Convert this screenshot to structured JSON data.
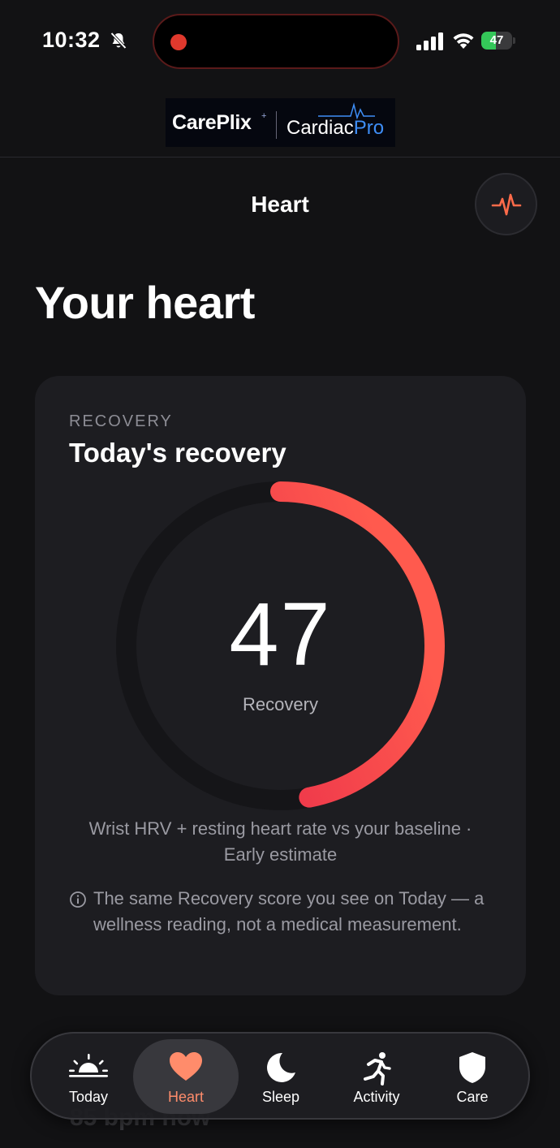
{
  "status_bar": {
    "time": "10:32",
    "battery_level": "47",
    "battery_fraction": 0.47,
    "icons": [
      "bell-slash-icon",
      "screen-recording-dot",
      "cellular-signal-icon",
      "wifi-icon",
      "battery-charging-icon"
    ]
  },
  "brand": {
    "primary": "CarePlix",
    "primary_mark": "+",
    "secondary_main": "Cardiac",
    "secondary_accent": "Pro"
  },
  "header": {
    "title": "Heart",
    "action_icon": "heartbeat-pulse-icon"
  },
  "page": {
    "heading": "Your heart"
  },
  "recovery_card": {
    "eyebrow": "RECOVERY",
    "title": "Today's recovery",
    "score": "47",
    "score_fraction": 0.47,
    "score_label": "Recovery",
    "method": "Wrist HRV + resting heart rate vs your baseline · Early estimate",
    "disclaimer": "The same Recovery score you see on Today — a wellness reading, not a medical measurement.",
    "colors": {
      "ring_start": "#e11d48",
      "ring_end": "#ff5a4e",
      "track": "#151518"
    }
  },
  "peek": {
    "text": "85 bpm now"
  },
  "tab_bar": {
    "active_color": "#ff8c6b",
    "tabs": [
      {
        "label": "Today",
        "icon": "sunrise-icon",
        "active": false
      },
      {
        "label": "Heart",
        "icon": "heart-icon",
        "active": true
      },
      {
        "label": "Sleep",
        "icon": "moon-icon",
        "active": false
      },
      {
        "label": "Activity",
        "icon": "running-person-icon",
        "active": false
      },
      {
        "label": "Care",
        "icon": "shield-icon",
        "active": false
      }
    ]
  }
}
